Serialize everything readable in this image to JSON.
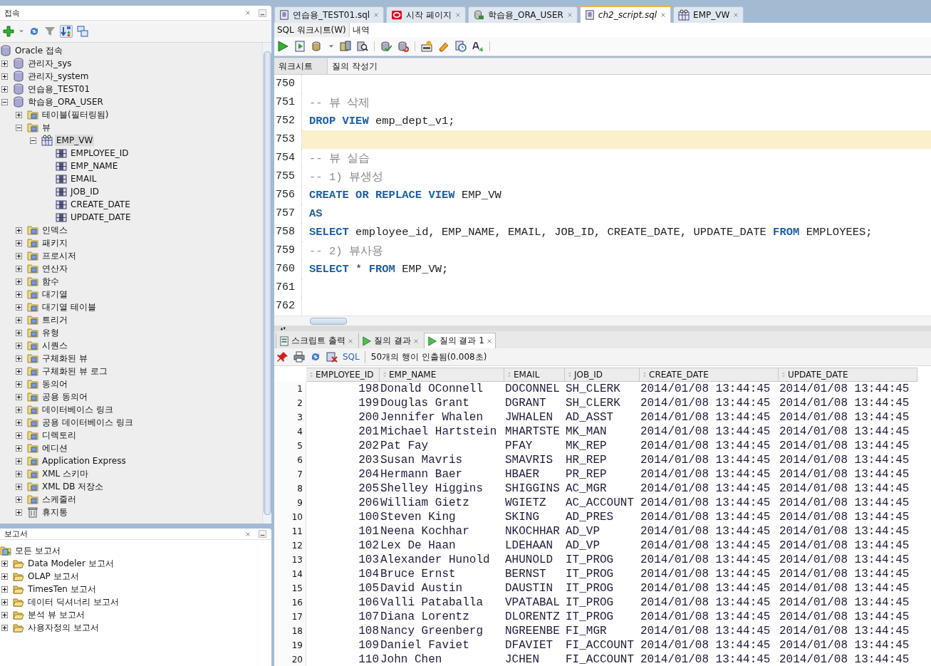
{
  "connections_panel": {
    "title": "접속",
    "tree": [
      {
        "label": "Oracle 접속",
        "kind": "connection",
        "selected": false,
        "children": [
          {
            "label": "관리자_sys",
            "kind": "connection",
            "expanded": false,
            "selected": false
          },
          {
            "label": "관리자_system",
            "kind": "connection",
            "expanded": false,
            "selected": false
          },
          {
            "label": "연습용_TEST01",
            "kind": "connection",
            "expanded": false,
            "selected": false
          },
          {
            "label": "학습용_ORA_USER",
            "kind": "connection",
            "expanded": true,
            "selected": false,
            "children": [
              {
                "label": "테이블(필터링됨)",
                "kind": "folder",
                "expanded": false,
                "selected": false
              },
              {
                "label": "뷰",
                "kind": "folder",
                "expanded": true,
                "selected": false,
                "children": [
                  {
                    "label": "EMP_VW",
                    "kind": "view",
                    "expanded": true,
                    "selected": true,
                    "children": [
                      {
                        "label": "EMPLOYEE_ID",
                        "kind": "column",
                        "selected": false
                      },
                      {
                        "label": "EMP_NAME",
                        "kind": "column",
                        "selected": false
                      },
                      {
                        "label": "EMAIL",
                        "kind": "column",
                        "selected": false
                      },
                      {
                        "label": "JOB_ID",
                        "kind": "column",
                        "selected": false
                      },
                      {
                        "label": "CREATE_DATE",
                        "kind": "column",
                        "selected": false
                      },
                      {
                        "label": "UPDATE_DATE",
                        "kind": "column",
                        "selected": false
                      }
                    ]
                  }
                ]
              },
              {
                "label": "인덱스",
                "kind": "folder",
                "expanded": false,
                "selected": false
              },
              {
                "label": "패키지",
                "kind": "folder",
                "expanded": false,
                "selected": false
              },
              {
                "label": "프로시저",
                "kind": "folder",
                "expanded": false,
                "selected": false
              },
              {
                "label": "연산자",
                "kind": "folder",
                "expanded": false,
                "selected": false
              },
              {
                "label": "함수",
                "kind": "folder",
                "expanded": false,
                "selected": false
              },
              {
                "label": "대기열",
                "kind": "folder",
                "expanded": false,
                "selected": false
              },
              {
                "label": "대기열 테이블",
                "kind": "folder",
                "expanded": false,
                "selected": false
              },
              {
                "label": "트리거",
                "kind": "folder",
                "expanded": false,
                "selected": false
              },
              {
                "label": "유형",
                "kind": "folder",
                "expanded": false,
                "selected": false
              },
              {
                "label": "시퀀스",
                "kind": "folder",
                "expanded": false,
                "selected": false
              },
              {
                "label": "구체화된 뷰",
                "kind": "folder",
                "expanded": false,
                "selected": false
              },
              {
                "label": "구체화된 뷰 로그",
                "kind": "folder",
                "expanded": false,
                "selected": false
              },
              {
                "label": "동의어",
                "kind": "folder",
                "expanded": false,
                "selected": false
              },
              {
                "label": "공용 동의어",
                "kind": "folder",
                "expanded": false,
                "selected": false
              },
              {
                "label": "데이터베이스 링크",
                "kind": "folder",
                "expanded": false,
                "selected": false
              },
              {
                "label": "공용 데이터베이스 링크",
                "kind": "folder",
                "expanded": false,
                "selected": false
              },
              {
                "label": "디렉토리",
                "kind": "folder",
                "expanded": false,
                "selected": false
              },
              {
                "label": "에디션",
                "kind": "folder",
                "expanded": false,
                "selected": false
              },
              {
                "label": "Application Express",
                "kind": "folder",
                "expanded": false,
                "selected": false
              },
              {
                "label": "XML 스키마",
                "kind": "folder",
                "expanded": false,
                "selected": false
              },
              {
                "label": "XML DB 저장소",
                "kind": "folder",
                "expanded": false,
                "selected": false
              },
              {
                "label": "스케줄러",
                "kind": "folder",
                "expanded": false,
                "selected": false
              },
              {
                "label": "휴지통",
                "kind": "bin",
                "expanded": false,
                "selected": false
              }
            ]
          }
        ]
      }
    ]
  },
  "reports_panel": {
    "title": "보고서",
    "tree": [
      {
        "label": "모든 보고서",
        "kind": "reports",
        "selected": false,
        "children": [
          {
            "label": "Data Modeler 보고서",
            "kind": "report-folder",
            "expanded": false,
            "selected": false
          },
          {
            "label": "OLAP 보고서",
            "kind": "report-folder",
            "expanded": false,
            "selected": false
          },
          {
            "label": "TimesTen 보고서",
            "kind": "report-folder",
            "expanded": false,
            "selected": false
          },
          {
            "label": "데이터 딕셔너리 보고서",
            "kind": "report-folder",
            "expanded": false,
            "selected": false
          },
          {
            "label": "분석 뷰 보고서",
            "kind": "report-folder",
            "expanded": false,
            "selected": false
          },
          {
            "label": "사용자정의 보고서",
            "kind": "report-folder",
            "expanded": false,
            "selected": false
          }
        ]
      }
    ]
  },
  "editor_tabs": [
    {
      "label": "연습용_TEST01.sql",
      "kind": "script",
      "selected": false
    },
    {
      "label": "시작 페이지",
      "kind": "start",
      "selected": false
    },
    {
      "label": "학습용_ORA_USER",
      "kind": "connection",
      "selected": false
    },
    {
      "label": "ch2_script.sql",
      "kind": "script",
      "selected": true
    },
    {
      "label": "EMP_VW",
      "kind": "view",
      "selected": false
    }
  ],
  "worksheet_tabs": [
    {
      "label": "SQL 워크시트(W)",
      "selected": true
    },
    {
      "label": "내역",
      "selected": false
    }
  ],
  "editor_mode_tabs": [
    {
      "label": "워크시트",
      "selected": true
    },
    {
      "label": "질의 작성기",
      "selected": false
    }
  ],
  "code_lines": [
    {
      "number": "750",
      "current": false
    },
    {
      "number": "751",
      "current": false,
      "tokens": [
        {
          "kind": "comment",
          "text": "-- 뷰 삭제"
        }
      ]
    },
    {
      "number": "752",
      "current": false,
      "tokens": [
        {
          "kind": "keyword",
          "text": "DROP VIEW"
        },
        {
          "kind": "plain",
          "text": " emp_dept_v1;"
        }
      ]
    },
    {
      "number": "753",
      "current": true
    },
    {
      "number": "754",
      "current": false,
      "tokens": [
        {
          "kind": "comment",
          "text": "-- 뷰 실습"
        }
      ]
    },
    {
      "number": "755",
      "current": false,
      "tokens": [
        {
          "kind": "comment",
          "text": "-- 1) 뷰생성"
        }
      ]
    },
    {
      "number": "756",
      "current": false,
      "tokens": [
        {
          "kind": "keyword",
          "text": "CREATE OR REPLACE VIEW"
        },
        {
          "kind": "plain",
          "text": " EMP_VW"
        }
      ]
    },
    {
      "number": "757",
      "current": false,
      "tokens": [
        {
          "kind": "keyword",
          "text": "AS"
        }
      ]
    },
    {
      "number": "758",
      "current": false,
      "tokens": [
        {
          "kind": "keyword",
          "text": "SELECT"
        },
        {
          "kind": "plain",
          "text": " employee_id, EMP_NAME, EMAIL, JOB_ID, CREATE_DATE, UPDATE_DATE "
        },
        {
          "kind": "keyword",
          "text": "FROM"
        },
        {
          "kind": "plain",
          "text": " EMPLOYEES;"
        }
      ]
    },
    {
      "number": "759",
      "current": false,
      "tokens": [
        {
          "kind": "comment",
          "text": "-- 2) 뷰사용"
        }
      ]
    },
    {
      "number": "760",
      "current": false,
      "tokens": [
        {
          "kind": "keyword",
          "text": "SELECT"
        },
        {
          "kind": "plain",
          "text": " * "
        },
        {
          "kind": "keyword",
          "text": "FROM"
        },
        {
          "kind": "plain",
          "text": " EMP_VW;"
        }
      ]
    },
    {
      "number": "761",
      "current": false
    },
    {
      "number": "762",
      "current": false
    }
  ],
  "result_tabs": [
    {
      "label": "스크립트 출력",
      "kind": "script-output",
      "selected": false
    },
    {
      "label": "질의 결과",
      "kind": "query-result",
      "selected": false
    },
    {
      "label": "질의 결과 1",
      "kind": "query-result",
      "selected": true
    }
  ],
  "result_toolbar": {
    "sql_link": "SQL",
    "status": "50개의 행이 인출됨(0.008초)"
  },
  "grid": {
    "columns": [
      "EMPLOYEE_ID",
      "EMP_NAME",
      "EMAIL",
      "JOB_ID",
      "CREATE_DATE",
      "UPDATE_DATE"
    ],
    "rows": [
      {
        "number": "1",
        "cells": [
          "198",
          "Donald OConnell",
          "DOCONNEL",
          "SH_CLERK",
          "2014/01/08 13:44:45",
          "2014/01/08 13:44:45"
        ]
      },
      {
        "number": "2",
        "cells": [
          "199",
          "Douglas Grant",
          "DGRANT",
          "SH_CLERK",
          "2014/01/08 13:44:45",
          "2014/01/08 13:44:45"
        ]
      },
      {
        "number": "3",
        "cells": [
          "200",
          "Jennifer Whalen",
          "JWHALEN",
          "AD_ASST",
          "2014/01/08 13:44:45",
          "2014/01/08 13:44:45"
        ]
      },
      {
        "number": "4",
        "cells": [
          "201",
          "Michael Hartstein",
          "MHARTSTE",
          "MK_MAN",
          "2014/01/08 13:44:45",
          "2014/01/08 13:44:45"
        ]
      },
      {
        "number": "5",
        "cells": [
          "202",
          "Pat Fay",
          "PFAY",
          "MK_REP",
          "2014/01/08 13:44:45",
          "2014/01/08 13:44:45"
        ]
      },
      {
        "number": "6",
        "cells": [
          "203",
          "Susan Mavris",
          "SMAVRIS",
          "HR_REP",
          "2014/01/08 13:44:45",
          "2014/01/08 13:44:45"
        ]
      },
      {
        "number": "7",
        "cells": [
          "204",
          "Hermann Baer",
          "HBAER",
          "PR_REP",
          "2014/01/08 13:44:45",
          "2014/01/08 13:44:45"
        ]
      },
      {
        "number": "8",
        "cells": [
          "205",
          "Shelley Higgins",
          "SHIGGINS",
          "AC_MGR",
          "2014/01/08 13:44:45",
          "2014/01/08 13:44:45"
        ]
      },
      {
        "number": "9",
        "cells": [
          "206",
          "William Gietz",
          "WGIETZ",
          "AC_ACCOUNT",
          "2014/01/08 13:44:45",
          "2014/01/08 13:44:45"
        ]
      },
      {
        "number": "10",
        "cells": [
          "100",
          "Steven King",
          "SKING",
          "AD_PRES",
          "2014/01/08 13:44:45",
          "2014/01/08 13:44:45"
        ]
      },
      {
        "number": "11",
        "cells": [
          "101",
          "Neena Kochhar",
          "NKOCHHAR",
          "AD_VP",
          "2014/01/08 13:44:45",
          "2014/01/08 13:44:45"
        ]
      },
      {
        "number": "12",
        "cells": [
          "102",
          "Lex De Haan",
          "LDEHAAN",
          "AD_VP",
          "2014/01/08 13:44:45",
          "2014/01/08 13:44:45"
        ]
      },
      {
        "number": "13",
        "cells": [
          "103",
          "Alexander Hunold",
          "AHUNOLD",
          "IT_PROG",
          "2014/01/08 13:44:45",
          "2014/01/08 13:44:45"
        ]
      },
      {
        "number": "14",
        "cells": [
          "104",
          "Bruce Ernst",
          "BERNST",
          "IT_PROG",
          "2014/01/08 13:44:45",
          "2014/01/08 13:44:45"
        ]
      },
      {
        "number": "15",
        "cells": [
          "105",
          "David Austin",
          "DAUSTIN",
          "IT_PROG",
          "2014/01/08 13:44:45",
          "2014/01/08 13:44:45"
        ]
      },
      {
        "number": "16",
        "cells": [
          "106",
          "Valli Pataballa",
          "VPATABAL",
          "IT_PROG",
          "2014/01/08 13:44:45",
          "2014/01/08 13:44:45"
        ]
      },
      {
        "number": "17",
        "cells": [
          "107",
          "Diana Lorentz",
          "DLORENTZ",
          "IT_PROG",
          "2014/01/08 13:44:45",
          "2014/01/08 13:44:45"
        ]
      },
      {
        "number": "18",
        "cells": [
          "108",
          "Nancy Greenberg",
          "NGREENBE",
          "FI_MGR",
          "2014/01/08 13:44:45",
          "2014/01/08 13:44:45"
        ]
      },
      {
        "number": "19",
        "cells": [
          "109",
          "Daniel Faviet",
          "DFAVIET",
          "FI_ACCOUNT",
          "2014/01/08 13:44:45",
          "2014/01/08 13:44:45"
        ]
      },
      {
        "number": "20",
        "cells": [
          "110",
          "John Chen",
          "JCHEN",
          "FI_ACCOUNT",
          "2014/01/08 13:44:45",
          "2014/01/08 13:44:45"
        ]
      }
    ]
  }
}
